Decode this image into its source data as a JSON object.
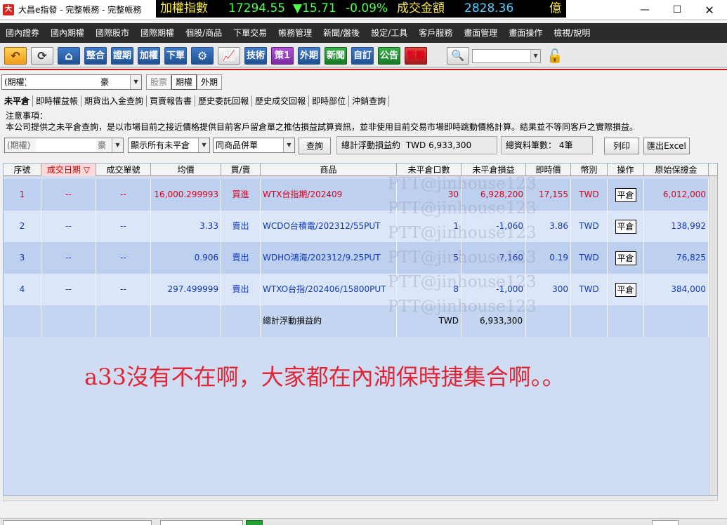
{
  "window": {
    "title": "大昌e指發 - 完整帳務 - 完整帳務",
    "app_icon": "大"
  },
  "ticker": {
    "index_label": "加權指數",
    "index_value": "17294.55",
    "change": "▼15.71",
    "change_pct": "-0.09%",
    "volume_label": "成交金額",
    "volume_value": "2828.36",
    "volume_unit": "億"
  },
  "menu": [
    "國內證券",
    "國內期權",
    "國際股市",
    "國際期權",
    "個股/商品",
    "下單交易",
    "帳務管理",
    "新聞/盤後",
    "設定/工具",
    "客戶服務",
    "畫面管理",
    "畫面操作",
    "檢視/說明"
  ],
  "toolbar": {
    "buttons": [
      "整合",
      "證期",
      "加權",
      "下單",
      "技術",
      "策1",
      "外期",
      "新聞",
      "自訂",
      "公告",
      "暫離"
    ]
  },
  "account": {
    "market_select": "(期權)",
    "account_suffix": "豪",
    "stock_tab": "股票",
    "futures_tab": "期權",
    "foreign_tab": "外期"
  },
  "subtabs": [
    "未平倉",
    "即時權益帳",
    "期貨出入金查詢",
    "買賣報告書",
    "歷史委託回報",
    "歷史成交回報",
    "即時部位",
    "沖銷查詢"
  ],
  "notice": {
    "title": "注意事項：",
    "text": "本公司提供之未平倉查詢，是以市場目前之接近價格提供目前客戶留倉單之推估損益試算資訊，並非使用目前交易市場即時跳動價格計算。結果並不等同客戶之實際損益。"
  },
  "filters": {
    "account_select": "(期權)",
    "account_suffix": "豪",
    "display_select": "顯示所有未平倉",
    "merge_select": "同商品併單",
    "query_button": "查詢",
    "total_pnl_label": "總計浮動損益約",
    "total_pnl_value": "TWD 6,933,300",
    "record_count_label": "總資料筆數：",
    "record_count_value": "4筆",
    "print_button": "列印",
    "export_button": "匯出Excel"
  },
  "table": {
    "columns": [
      "序號",
      "成交日期 ▽",
      "成交單號",
      "均價",
      "買/賣",
      "商品",
      "未平倉口數",
      "未平倉損益",
      "即時價",
      "幣別",
      "操作",
      "原始保證金"
    ],
    "rows": [
      {
        "seq": "1",
        "date": "--",
        "order_no": "--",
        "avg_price": "16,000.299993",
        "side": "買進",
        "product": "WTX台指期/202409",
        "qty": "30",
        "pnl": "6,928,200",
        "last": "17,155",
        "currency": "TWD",
        "action": "平倉",
        "margin": "6,012,000",
        "tone": "red"
      },
      {
        "seq": "2",
        "date": "--",
        "order_no": "--",
        "avg_price": "3.33",
        "side": "賣出",
        "product": "WCDO台積電/202312/55PUT",
        "qty": "1",
        "pnl": "-1,060",
        "last": "3.86",
        "currency": "TWD",
        "action": "平倉",
        "margin": "138,992",
        "tone": "blue"
      },
      {
        "seq": "3",
        "date": "--",
        "order_no": "--",
        "avg_price": "0.906",
        "side": "賣出",
        "product": "WDHO鴻海/202312/9.25PUT",
        "qty": "5",
        "pnl": "7,160",
        "last": "0.19",
        "currency": "TWD",
        "action": "平倉",
        "margin": "76,825",
        "tone": "blue"
      },
      {
        "seq": "4",
        "date": "--",
        "order_no": "--",
        "avg_price": "297.499999",
        "side": "賣出",
        "product": "WTXO台指/202406/15800PUT",
        "qty": "8",
        "pnl": "-1,000",
        "last": "300",
        "currency": "TWD",
        "action": "平倉",
        "margin": "384,000",
        "tone": "blue"
      }
    ],
    "total": {
      "label": "總計浮動損益約",
      "currency": "TWD",
      "value": "6,933,300"
    }
  },
  "watermark": "PTT@jinhouse123",
  "overlay_text": "a33沒有不在啊，大家都在內湖保時捷集合啊。。",
  "colors": {
    "accent_red": "#c2181e",
    "ticker_green": "#4cff4c",
    "buy_red": "#e0001b",
    "sell_blue": "#1038b8"
  }
}
